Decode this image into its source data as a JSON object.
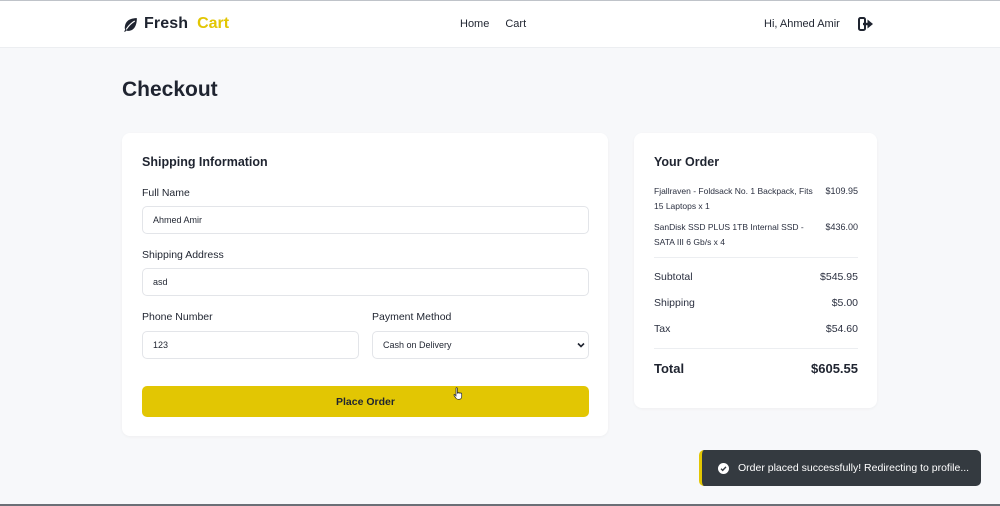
{
  "brand": {
    "name": "Fresh",
    "accent": "Cart",
    "accent_color": "#e2c603"
  },
  "nav": {
    "links": [
      "Home",
      "Cart"
    ],
    "greeting": "Hi, Ahmed Amir",
    "logout_icon": "logout-icon"
  },
  "page": {
    "title": "Checkout"
  },
  "shipping": {
    "heading": "Shipping Information",
    "full_name_label": "Full Name",
    "full_name_value": "Ahmed Amir",
    "address_label": "Shipping Address",
    "address_value": "asd",
    "phone_label": "Phone Number",
    "phone_value": "123",
    "payment_label": "Payment Method",
    "payment_selected": "Cash on Delivery",
    "submit_label": "Place Order"
  },
  "order": {
    "heading": "Your Order",
    "items": [
      {
        "name": "Fjallraven - Foldsack No. 1 Backpack, Fits 15 Laptops x 1",
        "price": "$109.95"
      },
      {
        "name": "SanDisk SSD PLUS 1TB Internal SSD - SATA III 6 Gb/s x 4",
        "price": "$436.00"
      }
    ],
    "subtotal_label": "Subtotal",
    "subtotal": "$545.95",
    "shipping_label": "Shipping",
    "shipping": "$5.00",
    "tax_label": "Tax",
    "tax": "$54.60",
    "total_label": "Total",
    "total": "$605.55"
  },
  "toast": {
    "message": "Order placed successfully! Redirecting to profile...",
    "icon": "check-circle-icon"
  }
}
